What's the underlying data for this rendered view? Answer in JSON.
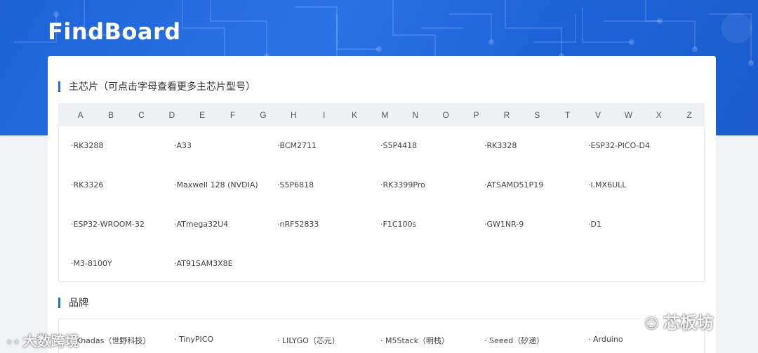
{
  "header": {
    "logo": "FindBoard"
  },
  "chip_section": {
    "title": "主芯片（可点击字母查看更多主芯片型号）",
    "letters": [
      "A",
      "B",
      "C",
      "D",
      "E",
      "F",
      "G",
      "H",
      "I",
      "K",
      "M",
      "N",
      "O",
      "P",
      "R",
      "S",
      "T",
      "V",
      "W",
      "X",
      "Z"
    ],
    "chips": [
      [
        "·RK3288",
        "·A33",
        "·BCM2711",
        "·S5P4418",
        "·RK3328",
        "·ESP32-PICO-D4"
      ],
      [
        "·RK3326",
        "·Maxwell 128 (NVDIA)",
        "·S5P6818",
        "·RK3399Pro",
        "·ATSAMD51P19",
        "·i.MX6ULL"
      ],
      [
        "·ESP32-WROOM-32",
        "·ATmega32U4",
        "·nRF52833",
        "·F1C100s",
        "·GW1NR-9",
        "·D1"
      ],
      [
        "·M3-8100Y",
        "·AT91SAM3X8E"
      ]
    ]
  },
  "brand_section": {
    "title": "品牌",
    "brands": [
      "· Khadas（世野科技）",
      "· TinyPICO",
      "· LILYGO（芯元）",
      "· M5Stack（明栈）",
      "· Seeed（矽递）",
      "· Arduino"
    ]
  },
  "watermarks": {
    "left": "大数跨境",
    "right": "芯板坊"
  },
  "colors": {
    "accent": "#1e6fe0",
    "hero": "#1d63d8"
  }
}
